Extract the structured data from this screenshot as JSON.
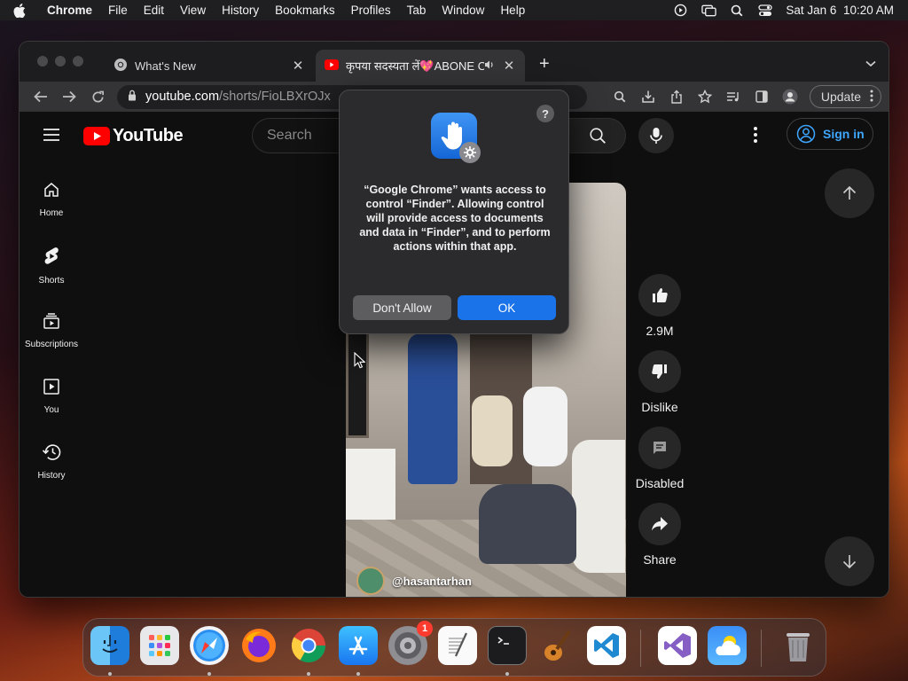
{
  "menubar": {
    "app_name": "Chrome",
    "items": [
      "File",
      "Edit",
      "View",
      "History",
      "Bookmarks",
      "Profiles",
      "Tab",
      "Window",
      "Help"
    ],
    "datetime": "Sat Jan 6  10:20 AM"
  },
  "browser": {
    "tabs": [
      {
        "title": "What's New",
        "icon": "chrome-icon",
        "active": false
      },
      {
        "title": "कृपया सदस्यता लें💖ABONE OL",
        "icon": "youtube-icon",
        "active": true
      }
    ],
    "address": {
      "host": "youtube.com",
      "path": "/shorts/FioLBXrOJx"
    },
    "update_label": "Update"
  },
  "youtube": {
    "logo_text": "YouTube",
    "search_placeholder": "Search",
    "sign_in": "Sign in",
    "sidebar": [
      {
        "label": "Home",
        "icon": "home-icon"
      },
      {
        "label": "Shorts",
        "icon": "shorts-icon"
      },
      {
        "label": "Subscriptions",
        "icon": "subscriptions-icon"
      },
      {
        "label": "You",
        "icon": "you-icon"
      },
      {
        "label": "History",
        "icon": "history-icon"
      }
    ],
    "short": {
      "channel": "@hasantarhan",
      "likes": "2.9M",
      "dislike_label": "Dislike",
      "comments_label": "Disabled",
      "share_label": "Share"
    }
  },
  "dialog": {
    "message": "“Google Chrome” wants access to control “Finder”. Allowing control will provide access to documents and data in “Finder”, and to perform actions within that app.",
    "deny_label": "Don't Allow",
    "ok_label": "OK",
    "help_label": "?"
  },
  "dock": {
    "items": [
      "finder",
      "launchpad",
      "safari",
      "firefox",
      "chrome",
      "app-store",
      "system-settings",
      "textedit",
      "terminal",
      "garageband",
      "vscode",
      "visual-studio",
      "weather",
      "trash"
    ],
    "settings_badge": "1"
  },
  "colors": {
    "youtube_red": "#ff0000",
    "link_blue": "#3ea6ff",
    "accent_blue": "#1a73e8"
  }
}
